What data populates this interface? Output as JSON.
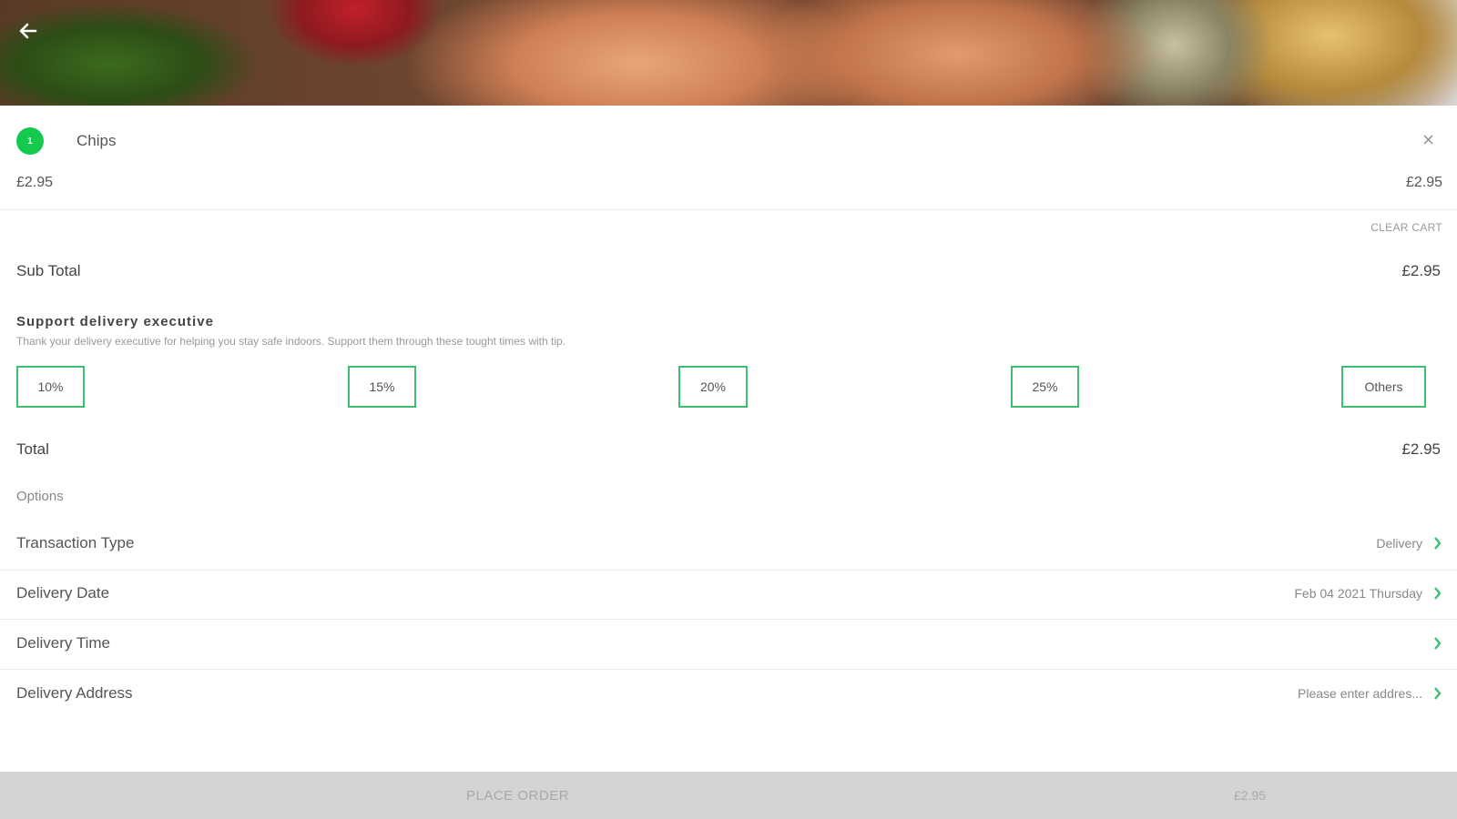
{
  "cart": {
    "item": {
      "badge": "1",
      "name": "Chips",
      "price": "£2.95",
      "line_total": "£2.95"
    },
    "clear_cart_label": "CLEAR CART"
  },
  "summary": {
    "subtotal_label": "Sub Total",
    "subtotal_value": "£2.95",
    "total_label": "Total",
    "total_value": "£2.95"
  },
  "tip": {
    "title": "Support delivery executive",
    "description": "Thank your delivery executive for helping you stay safe indoors. Support them through these tought times with tip.",
    "options": [
      "10%",
      "15%",
      "20%",
      "25%",
      "Others"
    ]
  },
  "options": {
    "heading": "Options",
    "rows": [
      {
        "label": "Transaction Type",
        "value": "Delivery"
      },
      {
        "label": "Delivery Date",
        "value": "Feb 04 2021 Thursday"
      },
      {
        "label": "Delivery Time",
        "value": ""
      },
      {
        "label": "Delivery Address",
        "value": "Please enter addres..."
      }
    ]
  },
  "footer": {
    "place_order_label": "PLACE ORDER",
    "total": "£2.95"
  },
  "colors": {
    "accent": "#3cbf6e",
    "veg_dot": "#15c94f",
    "footer_bg": "#d4d4d4"
  },
  "icons": {
    "back": "arrow-left-icon",
    "close": "close-icon",
    "chevron": "chevron-right-icon"
  }
}
